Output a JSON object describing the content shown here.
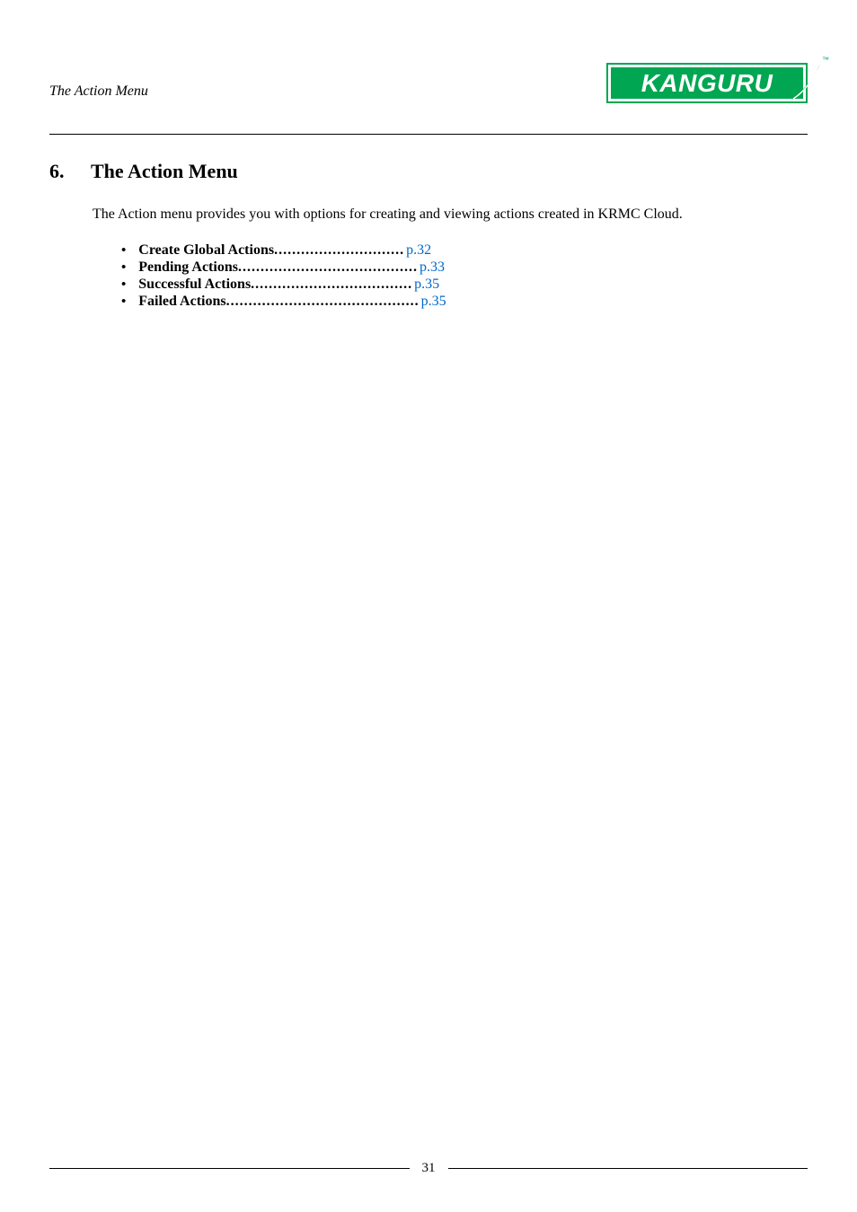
{
  "header": {
    "section_title": "The Action Menu",
    "logo_text": "KANGURU",
    "logo_tm": "™"
  },
  "section": {
    "number": "6.",
    "title": "The Action Menu"
  },
  "intro": "The Action menu provides you with options for creating and viewing actions created in KRMC Cloud.",
  "toc": [
    {
      "label": "Create Global Actions",
      "dots": ".............................",
      "page": "p.32"
    },
    {
      "label": "Pending Actions",
      "dots": "........................................",
      "page": "p.33"
    },
    {
      "label": "Successful Actions",
      "dots": "....................................",
      "page": "p.35"
    },
    {
      "label": "Failed Actions",
      "dots": "...........................................",
      "page": "p.35"
    }
  ],
  "footer": {
    "page_number": "31"
  }
}
